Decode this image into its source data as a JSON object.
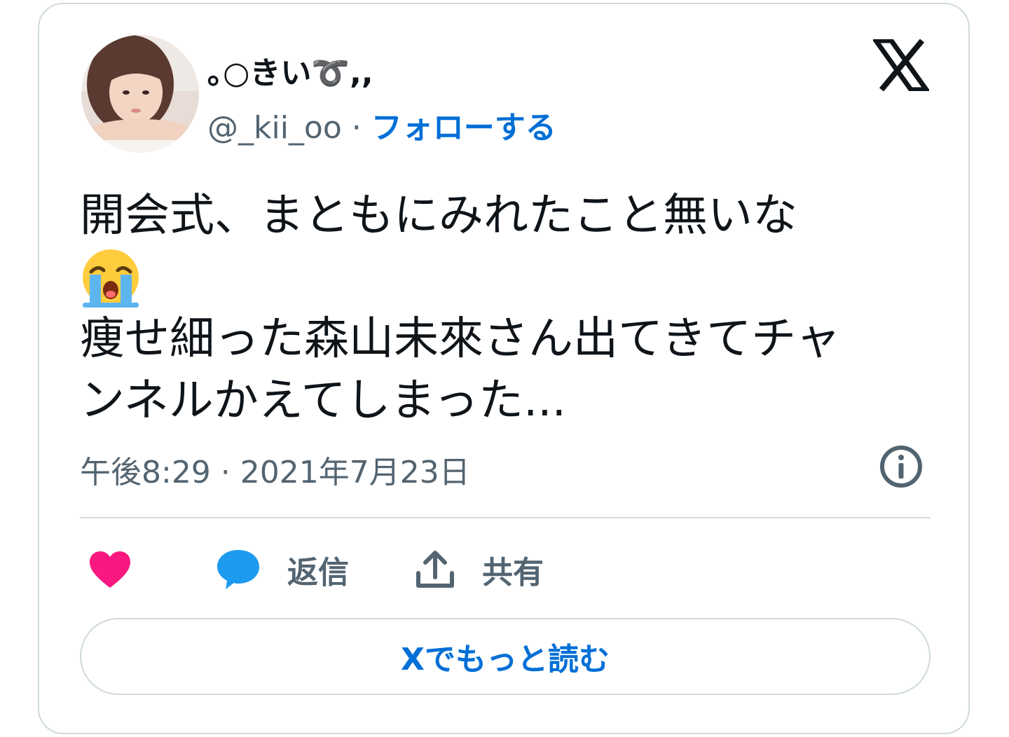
{
  "tweet": {
    "author": {
      "display_name": "｡○きい➰,,",
      "handle": "@_kii_oo",
      "separator": " · ",
      "follow_label": "フォローする"
    },
    "text_lines": [
      "開会式、まともにみれたこと無いな",
      "痩せ細った森山未來さん出てきてチャ",
      "ンネルかえてしまった..."
    ],
    "emoji": "loudly-crying-face",
    "timestamp": "午後8:29 · 2021年7月23日"
  },
  "actions": {
    "like_icon": "heart-icon",
    "reply_label": "返信",
    "share_label": "共有"
  },
  "read_more_label": "Xでもっと読む",
  "colors": {
    "link": "#006fd6",
    "muted": "#536471",
    "like": "#f91880",
    "reply": "#1d9bf0",
    "border": "#cfd9de"
  }
}
